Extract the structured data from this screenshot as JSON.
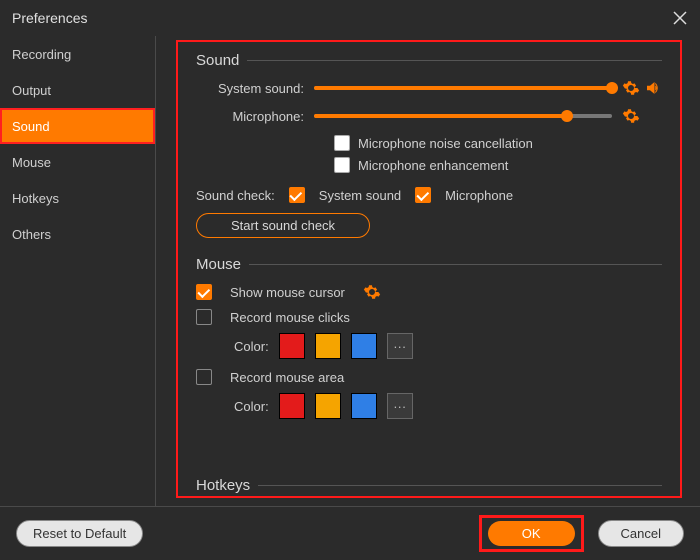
{
  "window": {
    "title": "Preferences"
  },
  "sidebar": {
    "items": [
      {
        "label": "Recording"
      },
      {
        "label": "Output"
      },
      {
        "label": "Sound"
      },
      {
        "label": "Mouse"
      },
      {
        "label": "Hotkeys"
      },
      {
        "label": "Others"
      }
    ],
    "active_index": 2
  },
  "sound": {
    "section_title": "Sound",
    "system_sound_label": "System sound:",
    "system_sound_percent": 100,
    "microphone_label": "Microphone:",
    "microphone_percent": 85,
    "noise_cancel_label": "Microphone noise cancellation",
    "noise_cancel_checked": false,
    "enhance_label": "Microphone enhancement",
    "enhance_checked": false,
    "sound_check_label": "Sound check:",
    "sc_system_label": "System sound",
    "sc_system_checked": true,
    "sc_mic_label": "Microphone",
    "sc_mic_checked": true,
    "start_check_label": "Start sound check"
  },
  "mouse": {
    "section_title": "Mouse",
    "show_cursor_label": "Show mouse cursor",
    "show_cursor_checked": true,
    "record_clicks_label": "Record mouse clicks",
    "record_clicks_checked": false,
    "record_area_label": "Record mouse area",
    "record_area_checked": false,
    "color_label": "Color:",
    "swatches": [
      "#e31b1b",
      "#f5a400",
      "#2f7fe6"
    ],
    "more_label": "···"
  },
  "hotkeys_peek": "Hotkeys",
  "footer": {
    "reset_label": "Reset to Default",
    "ok_label": "OK",
    "cancel_label": "Cancel"
  }
}
